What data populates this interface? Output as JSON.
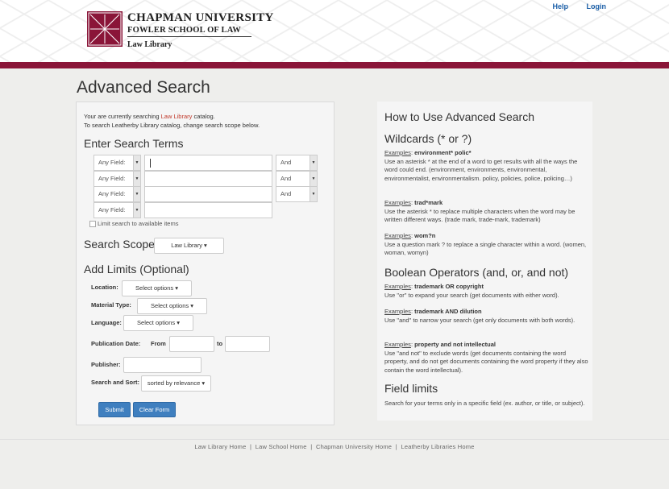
{
  "header": {
    "university": "CHAPMAN UNIVERSITY",
    "school": "FOWLER SCHOOL OF LAW",
    "library": "Law Library",
    "help_link": "Help",
    "login_link": "Login"
  },
  "page_title": "Advanced Search",
  "left": {
    "scope_prefix": "Your are currently searching ",
    "scope_link": "Law Library",
    "scope_suffix": " catalog.",
    "scope_note2": "To search Leatherby Library catalog, change search scope below.",
    "enter_terms_heading": "Enter Search Terms",
    "rows": [
      {
        "field": "Any Field:",
        "op": "And"
      },
      {
        "field": "Any Field:",
        "op": "And"
      },
      {
        "field": "Any Field:",
        "op": "And"
      },
      {
        "field": "Any Field:"
      }
    ],
    "limit_available": "Limit search to available items",
    "search_scope_heading": "Search Scope",
    "search_scope_value": "Law Library ▾",
    "add_limits_heading": "Add Limits (Optional)",
    "location_label": "Location:",
    "material_label": "Material Type:",
    "language_label": "Language:",
    "select_options": "Select options ▾",
    "pub_date_label": "Publication Date:",
    "from_label": "From",
    "to_label": "to",
    "publisher_label": "Publisher:",
    "sort_label": "Search and Sort:",
    "sort_value": "sorted by relevance ▾",
    "submit": "Submit",
    "clear": "Clear Form"
  },
  "right": {
    "how_heading": "How to Use Advanced Search",
    "wildcards_heading": "Wildcards (* or ?)",
    "examples": "Examples",
    "ex1_term": "environment* polic*",
    "ex1_desc": "Use an asterisk * at the end of a word to get results with all the ways the word could end. (environment, environments, environmental, environmentalist, environmentalism. policy, policies, police, policing…)",
    "ex2_term": "trad*mark",
    "ex2_desc": "Use the asterisk * to replace multiple characters when the word may be written different ways. (trade mark, trade-mark, trademark)",
    "ex3_term": "wom?n",
    "ex3_desc": "Use a question mark ? to replace a single character within a word. (women, woman, womyn)",
    "boolean_heading": "Boolean Operators (and, or, and not)",
    "ex4_term": "trademark OR copyright",
    "ex4_desc": "Use \"or\" to expand your search (get documents with either word).",
    "ex5_term": "trademark AND dilution",
    "ex5_desc": "Use \"and\" to narrow your search (get only documents with both words).",
    "ex6_term": "property and not intellectual",
    "ex6_desc": "Use \"and not\" to exclude words (get documents containing the word property, and do not get documents containing the word property if they also contain the word intellectual).",
    "field_limits_heading": "Field limits",
    "field_limits_desc": "Search for your terms only in a specific field (ex. author, or title, or subject)."
  },
  "footer": {
    "link1": "Law Library Home",
    "link2": "Law School Home",
    "link3": "Chapman University Home",
    "link4": "Leatherby Libraries Home",
    "sep": "|"
  },
  "colors": {
    "brand_crimson": "#8a1538",
    "link_blue": "#1b5fa8",
    "button_blue": "#3f7fbf"
  }
}
